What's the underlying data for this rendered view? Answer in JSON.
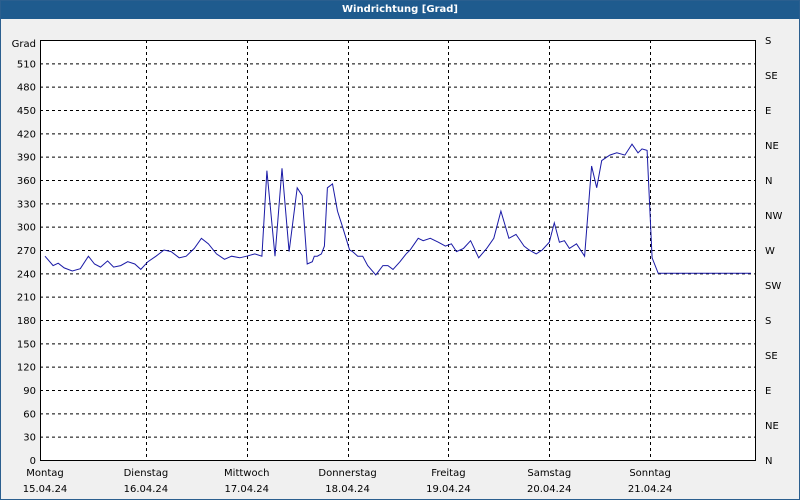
{
  "window": {
    "title": "Windrichtung [Grad]"
  },
  "chart_data": {
    "type": "line",
    "title": "Windrichtung [Grad]",
    "ylabel": "Grad",
    "ylim": [
      0,
      540
    ],
    "yticks": [
      0,
      30,
      60,
      90,
      120,
      150,
      180,
      210,
      240,
      270,
      300,
      330,
      360,
      390,
      420,
      450,
      480,
      510
    ],
    "right_axis_labels": [
      {
        "value": 0,
        "label": "N"
      },
      {
        "value": 45,
        "label": "NE"
      },
      {
        "value": 90,
        "label": "E"
      },
      {
        "value": 135,
        "label": "SE"
      },
      {
        "value": 180,
        "label": "S"
      },
      {
        "value": 225,
        "label": "SW"
      },
      {
        "value": 270,
        "label": "W"
      },
      {
        "value": 315,
        "label": "NW"
      },
      {
        "value": 360,
        "label": "N"
      },
      {
        "value": 405,
        "label": "NE"
      },
      {
        "value": 450,
        "label": "E"
      },
      {
        "value": 495,
        "label": "SE"
      },
      {
        "value": 540,
        "label": "S"
      }
    ],
    "x_unit": "days",
    "xlim": [
      -0.05,
      7.05
    ],
    "day_labels": [
      {
        "day": "Montag",
        "date": "15.04.24"
      },
      {
        "day": "Dienstag",
        "date": "16.04.24"
      },
      {
        "day": "Mittwoch",
        "date": "17.04.24"
      },
      {
        "day": "Donnerstag",
        "date": "18.04.24"
      },
      {
        "day": "Freitag",
        "date": "19.04.24"
      },
      {
        "day": "Samstag",
        "date": "20.04.24"
      },
      {
        "day": "Sonntag",
        "date": "21.04.24"
      }
    ],
    "grid": true,
    "line_color": "#1a1aa6",
    "series": [
      {
        "x": [
          0.0,
          0.08,
          0.13,
          0.19,
          0.27,
          0.35,
          0.43,
          0.49,
          0.55,
          0.62,
          0.68,
          0.75,
          0.82,
          0.89,
          0.95,
          1.02,
          1.1,
          1.18,
          1.25,
          1.33,
          1.4,
          1.48,
          1.55,
          1.62,
          1.7,
          1.78,
          1.85,
          1.93,
          2.0,
          2.08,
          2.15,
          2.2,
          2.28,
          2.35,
          2.42,
          2.5,
          2.55,
          2.6,
          2.65,
          2.67,
          2.7,
          2.74,
          2.77,
          2.8,
          2.85,
          2.9,
          2.95,
          3.02,
          3.05,
          3.1,
          3.15,
          3.2,
          3.28,
          3.35,
          3.4,
          3.45,
          3.52,
          3.58,
          3.62,
          3.7,
          3.75,
          3.82,
          3.9,
          3.97,
          4.03,
          4.08,
          4.15,
          4.22,
          4.3,
          4.38,
          4.45,
          4.52,
          4.6,
          4.67,
          4.75,
          4.8,
          4.87,
          4.93,
          5.0,
          5.05,
          5.1,
          5.15,
          5.2,
          5.27,
          5.35,
          5.42,
          5.47,
          5.52,
          5.6,
          5.67,
          5.75,
          5.82,
          5.88,
          5.92,
          5.97,
          6.02,
          6.08,
          6.13,
          6.2,
          6.27,
          6.33,
          6.4,
          6.45,
          6.5,
          6.55,
          6.6,
          6.65,
          6.7,
          6.75,
          6.82,
          6.9,
          6.93,
          6.96,
          7.0
        ],
        "y": [
          262,
          250,
          253,
          247,
          243,
          246,
          262,
          252,
          248,
          256,
          248,
          250,
          255,
          252,
          245,
          255,
          262,
          270,
          268,
          260,
          262,
          272,
          285,
          278,
          265,
          258,
          262,
          260,
          262,
          265,
          262,
          372,
          262,
          375,
          268,
          350,
          340,
          252,
          255,
          262,
          262,
          265,
          275,
          350,
          355,
          320,
          300,
          270,
          268,
          262,
          262,
          250,
          238,
          250,
          250,
          245,
          255,
          265,
          270,
          285,
          282,
          285,
          280,
          275,
          278,
          268,
          272,
          282,
          260,
          272,
          285,
          320,
          285,
          290,
          275,
          270,
          265,
          270,
          280,
          305,
          280,
          282,
          272,
          278,
          262,
          378,
          350,
          385,
          392,
          395,
          392,
          406,
          395,
          400,
          398,
          260,
          240,
          240,
          240,
          240,
          240,
          240,
          240,
          240,
          240,
          240,
          240,
          240,
          240,
          240,
          240,
          240,
          240,
          240
        ],
        "_note_ignore": ""
      }
    ]
  }
}
